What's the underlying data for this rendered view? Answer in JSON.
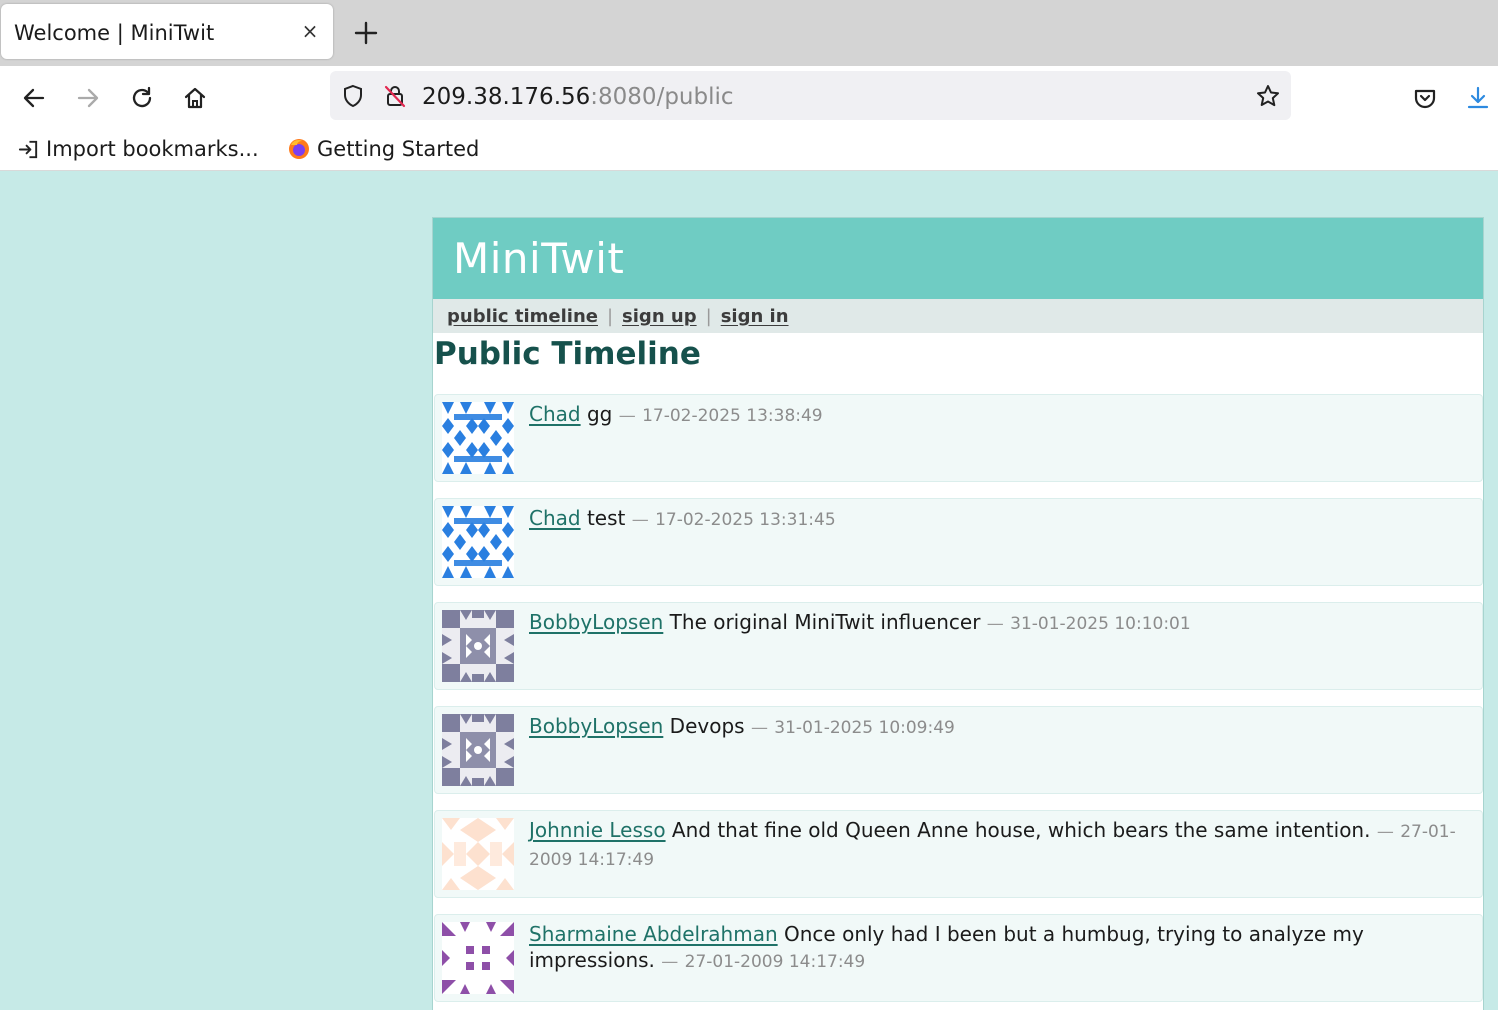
{
  "browser": {
    "tab_title": "Welcome | MiniTwit",
    "tab_close": "×",
    "url_host": "209.38.176.56",
    "url_rest": ":8080/public",
    "bookmarks": [
      {
        "label": "Import bookmarks...",
        "icon": "import-icon"
      },
      {
        "label": "Getting Started",
        "icon": "firefox-icon"
      }
    ]
  },
  "site": {
    "title": "MiniTwit",
    "nav": {
      "public_timeline": "public timeline",
      "sign_up": "sign up",
      "sign_in": "sign in",
      "separator": "|"
    },
    "page_title": "Public Timeline"
  },
  "messages": [
    {
      "user": "Chad",
      "text": "gg",
      "time": "17-02-2025 13:38:49",
      "avatar_color": "#2a7fe0"
    },
    {
      "user": "Chad",
      "text": "test",
      "time": "17-02-2025 13:31:45",
      "avatar_color": "#2a7fe0"
    },
    {
      "user": "BobbyLopsen",
      "text": "The original MiniTwit influencer",
      "time": "31-01-2025 10:10:01",
      "avatar_color": "#7e7f9e"
    },
    {
      "user": "BobbyLopsen",
      "text": "Devops",
      "time": "31-01-2025 10:09:49",
      "avatar_color": "#7e7f9e"
    },
    {
      "user": "Johnnie Lesso",
      "text": "And that fine old Queen Anne house, which bears the same intention.",
      "time": "27-01-2009 14:17:49",
      "avatar_color": "#fde1cf"
    },
    {
      "user": "Sharmaine Abdelrahman",
      "text": "Once only had I been but a humbug, trying to analyze my impressions.",
      "time": "27-01-2009 14:17:49",
      "avatar_color": "#8e4fa8"
    }
  ],
  "dash": "—"
}
